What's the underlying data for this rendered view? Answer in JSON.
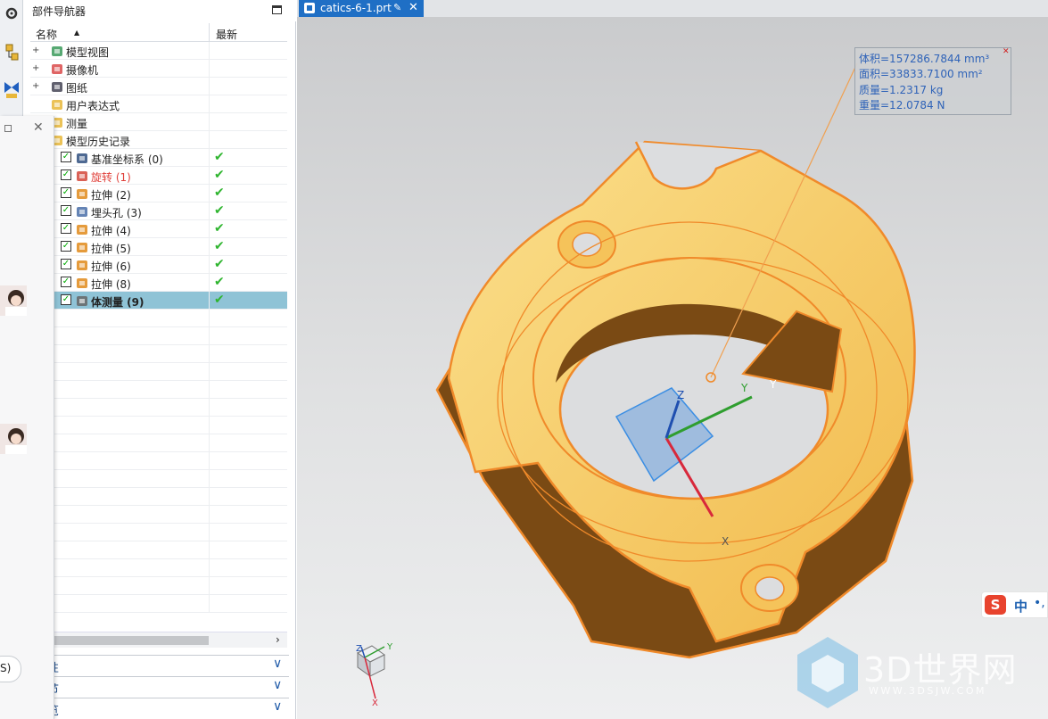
{
  "navigator": {
    "title": "部件导航器",
    "col_name": "名称",
    "col_latest": "最新",
    "rows": [
      {
        "label": "模型视图",
        "level": 0,
        "expander": "+",
        "latest": ""
      },
      {
        "label": "摄像机",
        "level": 0,
        "expander": "+",
        "latest": ""
      },
      {
        "label": "图纸",
        "level": 0,
        "expander": "+",
        "latest": ""
      },
      {
        "label": "用户表达式",
        "level": 0,
        "expander": "",
        "latest": ""
      },
      {
        "label": "测量",
        "level": 0,
        "expander": "",
        "latest": ""
      },
      {
        "label": "模型历史记录",
        "level": 0,
        "expander": "",
        "latest": ""
      },
      {
        "label": "基准坐标系 (0)",
        "level": 1,
        "checked": true,
        "latest": "✔"
      },
      {
        "label": "旋转 (1)",
        "level": 1,
        "checked": true,
        "latest": "✔",
        "style": "red"
      },
      {
        "label": "拉伸 (2)",
        "level": 1,
        "checked": true,
        "latest": "✔"
      },
      {
        "label": "埋头孔 (3)",
        "level": 1,
        "checked": true,
        "latest": "✔"
      },
      {
        "label": "拉伸 (4)",
        "level": 1,
        "checked": true,
        "latest": "✔"
      },
      {
        "label": "拉伸 (5)",
        "level": 1,
        "checked": true,
        "latest": "✔"
      },
      {
        "label": "拉伸 (6)",
        "level": 1,
        "checked": true,
        "latest": "✔"
      },
      {
        "label": "拉伸 (8)",
        "level": 1,
        "checked": true,
        "latest": "✔"
      },
      {
        "label": "体测量 (9)",
        "level": 1,
        "checked": true,
        "latest": "✔",
        "style": "bold",
        "selected": true
      }
    ],
    "sections": [
      {
        "label": "关性"
      },
      {
        "label": "细节"
      },
      {
        "label": "预览"
      }
    ]
  },
  "overlay": {
    "pill_text": "S)"
  },
  "document_tab": {
    "name": "catics-6-1.prt",
    "close_glyph": "✕"
  },
  "measurement": {
    "volume": "体积=157286.7844 mm³",
    "area": "面积=33833.7100 mm²",
    "mass": "质量=1.2317 kg",
    "weight": "重量=12.0784 N"
  },
  "axes_labels": {
    "x": "X",
    "y": "Y",
    "z": "Z"
  },
  "ime": {
    "logo": "S",
    "lang": "中",
    "punct": "•,"
  },
  "watermark": {
    "title": "3D世界网",
    "url": "WWW.3DSJW.COM"
  },
  "colors": {
    "part_fill": "#f5c35a",
    "part_shadow": "#7a4a14",
    "part_edge": "#f08a2a",
    "selection_blue": "#8fc3d6",
    "tab_blue": "#1f6fc5",
    "check_green": "#2fb52f"
  }
}
